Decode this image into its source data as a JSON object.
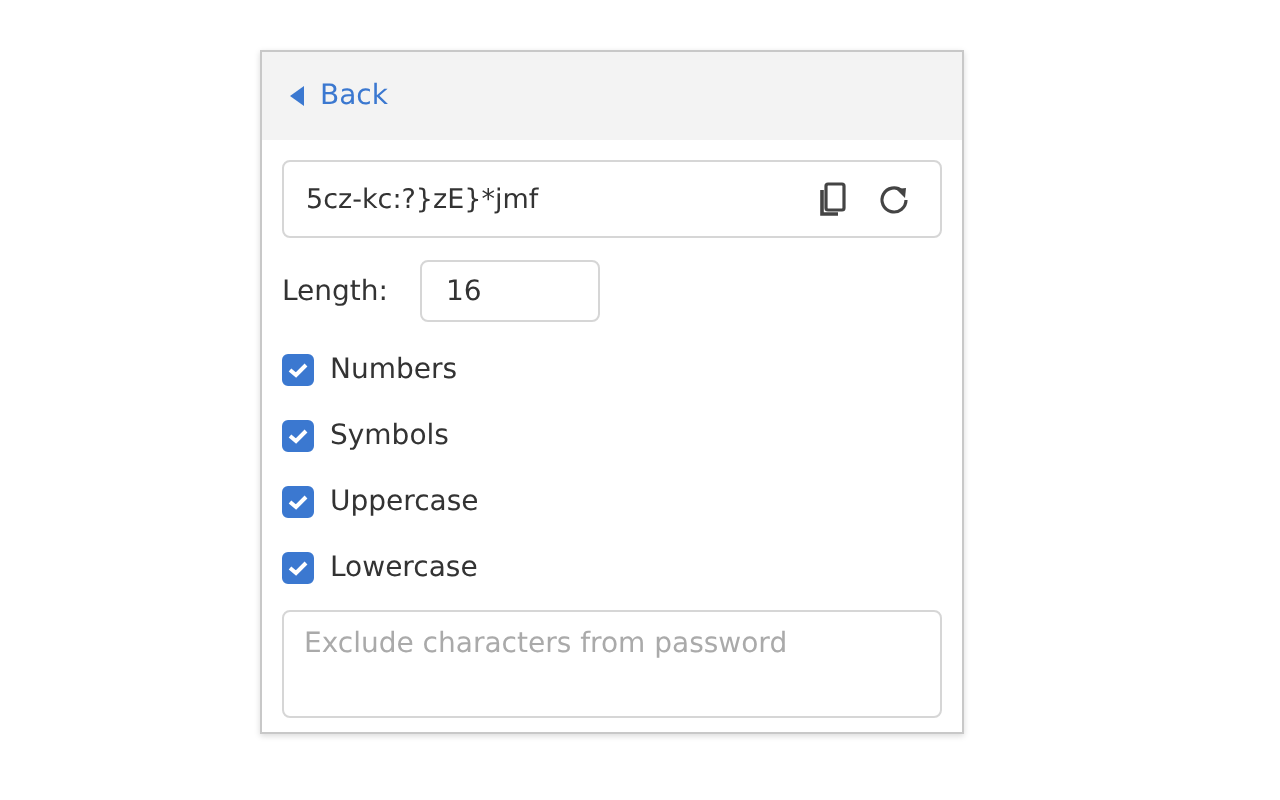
{
  "header": {
    "back_label": "Back"
  },
  "password": {
    "value": "5cz-kc:?}zE}*jmf"
  },
  "length": {
    "label": "Length:",
    "value": "16"
  },
  "options": [
    {
      "label": "Numbers",
      "checked": true
    },
    {
      "label": "Symbols",
      "checked": true
    },
    {
      "label": "Uppercase",
      "checked": true
    },
    {
      "label": "Lowercase",
      "checked": true
    }
  ],
  "exclude": {
    "placeholder": "Exclude characters from password"
  }
}
